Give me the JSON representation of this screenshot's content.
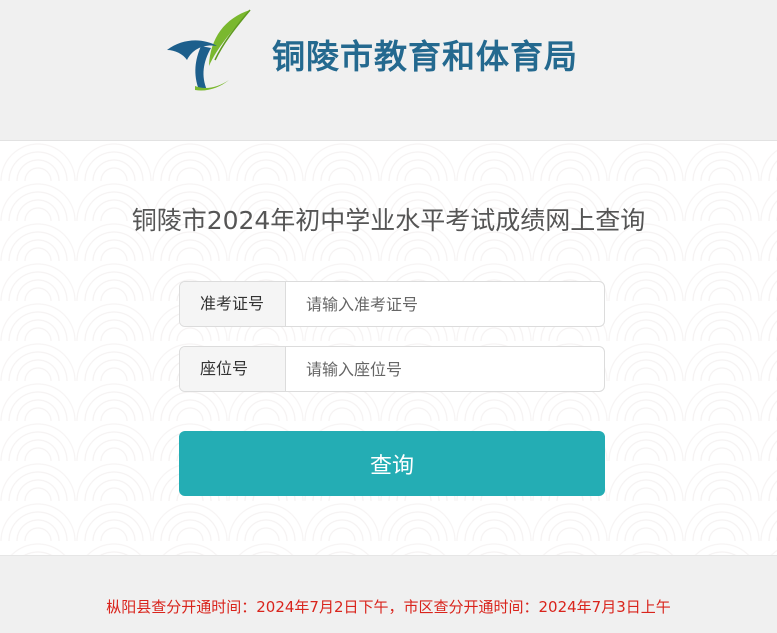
{
  "header": {
    "org_name": "铜陵市教育和体育局"
  },
  "main": {
    "title": "铜陵市2024年初中学业水平考试成绩网上查询",
    "fields": [
      {
        "label": "准考证号",
        "value": "",
        "placeholder": "请输入准考证号"
      },
      {
        "label": "座位号",
        "value": "",
        "placeholder": "请输入座位号"
      }
    ],
    "submit_label": "查询"
  },
  "footer": {
    "notice": "枞阳县查分开通时间：2024年7月2日下午，市区查分开通时间：2024年7月3日上午"
  },
  "colors": {
    "brand_text": "#24698f",
    "button": "#24adb4",
    "notice": "#d9241c",
    "logo_green": "#7ab82e",
    "logo_blue": "#1d5f8c"
  },
  "icons": {
    "logo": "bureau-logo-emblem"
  }
}
